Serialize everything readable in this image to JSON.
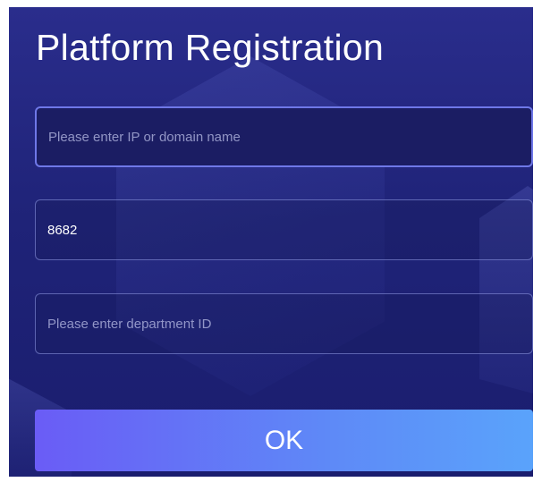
{
  "dialog": {
    "title": "Platform Registration"
  },
  "fields": {
    "address": {
      "value": "",
      "placeholder": "Please enter IP or domain name"
    },
    "port": {
      "value": "8682",
      "placeholder": ""
    },
    "department": {
      "value": "",
      "placeholder": "Please enter department ID"
    }
  },
  "actions": {
    "ok_label": "OK"
  },
  "colors": {
    "background": "#1f2378",
    "focus_border": "#6f78e8",
    "button_gradient_start": "#6a5cf6",
    "button_gradient_end": "#5aa3fb"
  }
}
